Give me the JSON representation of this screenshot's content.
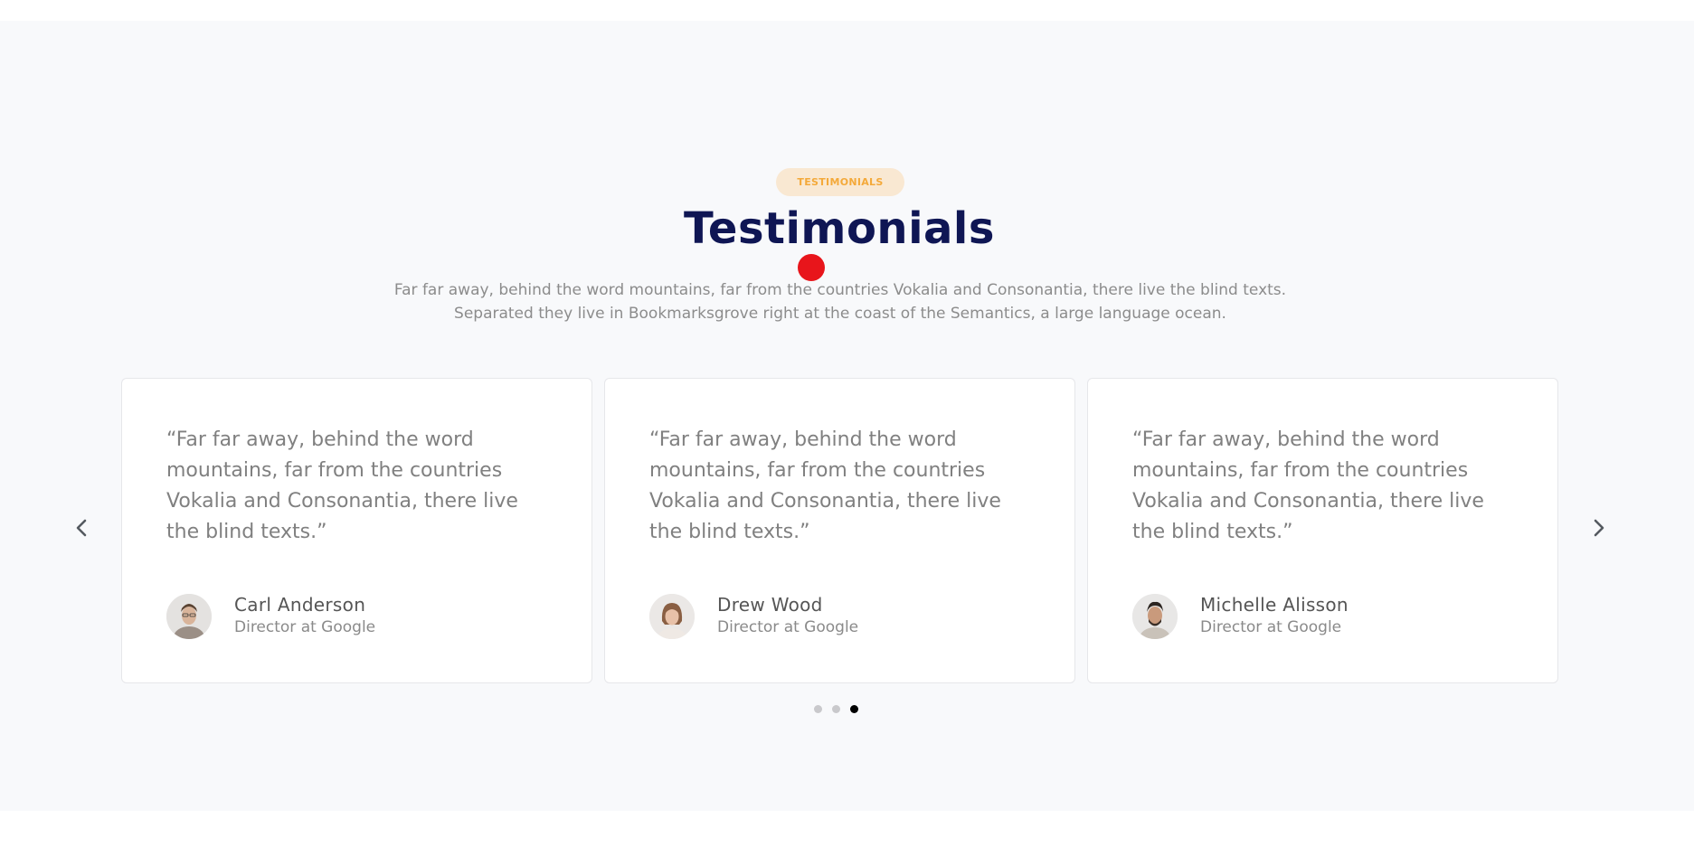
{
  "section": {
    "badge": "TESTIMONIALS",
    "title": "Testimonials",
    "subtitle": "Far far away, behind the word mountains, far from the countries Vokalia and Consonantia, there live the blind texts. Separated they live in Bookmarksgrove right at the coast of the Semantics, a large language ocean."
  },
  "testimonials": [
    {
      "quote": "“Far far away, behind the word mountains, far from the countries Vokalia and Consonantia, there live the blind texts.”",
      "name": "Carl Anderson",
      "role": "Director at Google"
    },
    {
      "quote": "“Far far away, behind the word mountains, far from the countries Vokalia and Consonantia, there live the blind texts.”",
      "name": "Drew Wood",
      "role": "Director at Google"
    },
    {
      "quote": "“Far far away, behind the word mountains, far from the countries Vokalia and Consonantia, there live the blind texts.”",
      "name": "Michelle Alisson",
      "role": "Director at Google"
    }
  ],
  "carousel": {
    "prev_icon": "chevron-left-icon",
    "next_icon": "chevron-right-icon",
    "active_dot": 3,
    "dot_count": 3
  },
  "colors": {
    "badge_bg": "#f9e8d2",
    "badge_text": "#f4a93a",
    "title": "#0f1654",
    "section_bg": "#f8f9fb",
    "cursor_marker": "#e8151b"
  }
}
